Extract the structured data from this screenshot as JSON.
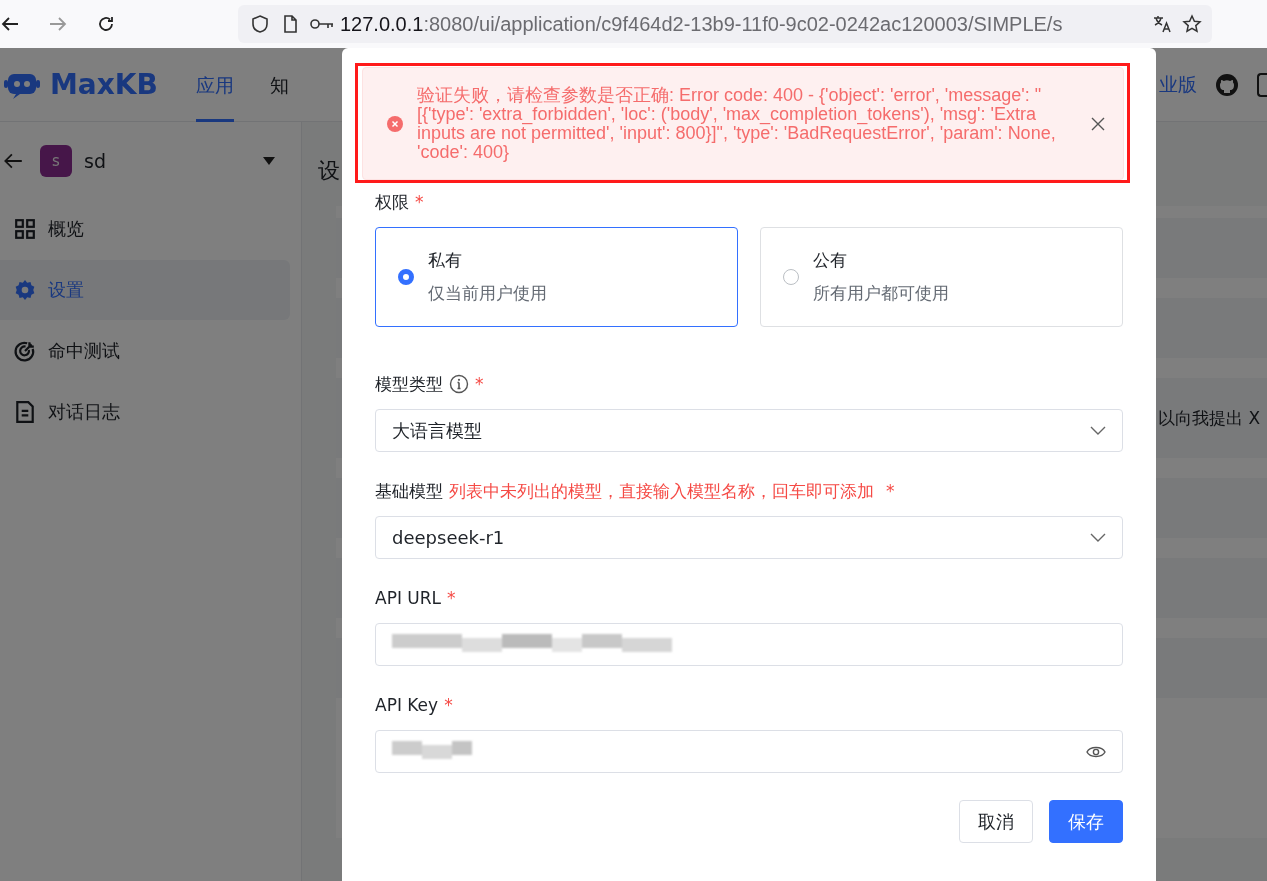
{
  "browser": {
    "url_host": "127.0.0.1",
    "url_rest": ":8080/ui/application/c9f464d2-13b9-11f0-9c02-0242ac120003/SIMPLE/s"
  },
  "header": {
    "logo": "MaxKB",
    "nav": [
      {
        "label": "应用",
        "selected": true
      },
      {
        "label": "知",
        "selected": false
      }
    ],
    "edition": "业版"
  },
  "sidebar": {
    "app_avatar": "s",
    "app_name": "sd",
    "items": [
      {
        "label": "概览",
        "selected": false
      },
      {
        "label": "设置",
        "selected": true
      },
      {
        "label": "命中测试",
        "selected": false
      },
      {
        "label": "对话日志",
        "selected": false
      }
    ]
  },
  "main": {
    "title": "设",
    "prompt_snippet": "以向我提出 X"
  },
  "dialog": {
    "error": {
      "message": "验证失败，请检查参数是否正确: Error code: 400 - {'object': 'error', 'message': \"[{'type': 'extra_forbidden', 'loc': ('body', 'max_completion_tokens'), 'msg': 'Extra inputs are not permitted', 'input': 800}]\", 'type': 'BadRequestError', 'param': None, 'code': 400}"
    },
    "permission": {
      "label": "权限",
      "required_mark": "*",
      "options": [
        {
          "title": "私有",
          "description": "仅当前用户使用",
          "selected": true
        },
        {
          "title": "公有",
          "description": "所有用户都可使用",
          "selected": false
        }
      ]
    },
    "fields": [
      {
        "kind": "select",
        "label": "模型类型",
        "info": true,
        "required_mark": "*",
        "value": "大语言模型"
      },
      {
        "kind": "select",
        "label": "基础模型",
        "hint": "列表中未列出的模型，直接输入模型名称，回车即可添加",
        "required_mark": "*",
        "value": "deepseek-r1"
      },
      {
        "kind": "input",
        "label": "API URL",
        "required_mark": "*",
        "redacted": true
      },
      {
        "kind": "password",
        "label": "API Key",
        "required_mark": "*",
        "redacted": true
      }
    ],
    "buttons": [
      {
        "label": "取消",
        "kind": "secondary"
      },
      {
        "label": "保存",
        "kind": "primary"
      }
    ]
  }
}
